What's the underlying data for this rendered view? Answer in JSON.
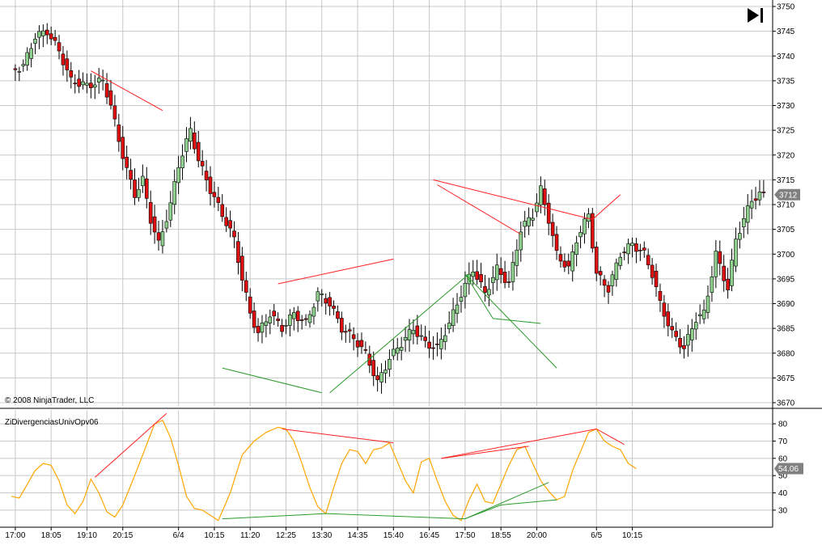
{
  "copyright": "© 2008 NinjaTrader, LLC",
  "play_icon": "skip-to-end-icon",
  "colors": {
    "up_candle": "#8fd08f",
    "down_candle": "#e01010",
    "grid": "#c8c8c8",
    "bearish_line": "#ff2020",
    "bullish_line": "#2a9a2a",
    "oscillator": "#ffa500",
    "last_badge": "#808080"
  },
  "chart_data": [
    {
      "type": "candlestick",
      "ylim": [
        3670,
        3750
      ],
      "yticks": [
        3670,
        3675,
        3680,
        3685,
        3690,
        3695,
        3700,
        3705,
        3710,
        3715,
        3720,
        3725,
        3730,
        3735,
        3740,
        3745,
        3750
      ],
      "last_price": "3712",
      "close_anchors": [
        [
          0,
          3737
        ],
        [
          3,
          3738
        ],
        [
          6,
          3744
        ],
        [
          9,
          3745
        ],
        [
          12,
          3741
        ],
        [
          15,
          3735
        ],
        [
          19,
          3734
        ],
        [
          23,
          3735
        ],
        [
          25,
          3730
        ],
        [
          27,
          3723
        ],
        [
          29,
          3717
        ],
        [
          31,
          3712
        ],
        [
          33,
          3715
        ],
        [
          35,
          3707
        ],
        [
          37,
          3702
        ],
        [
          40,
          3710
        ],
        [
          42,
          3718
        ],
        [
          45,
          3725
        ],
        [
          47,
          3719
        ],
        [
          50,
          3713
        ],
        [
          53,
          3708
        ],
        [
          56,
          3703
        ],
        [
          58,
          3695
        ],
        [
          60,
          3688
        ],
        [
          62,
          3684
        ],
        [
          65,
          3688
        ],
        [
          68,
          3685
        ],
        [
          71,
          3688
        ],
        [
          74,
          3686
        ],
        [
          77,
          3692
        ],
        [
          80,
          3690
        ],
        [
          83,
          3685
        ],
        [
          86,
          3683
        ],
        [
          89,
          3680
        ],
        [
          92,
          3674
        ],
        [
          95,
          3679
        ],
        [
          98,
          3682
        ],
        [
          101,
          3685
        ],
        [
          104,
          3682
        ],
        [
          107,
          3681
        ],
        [
          110,
          3686
        ],
        [
          113,
          3692
        ],
        [
          116,
          3697
        ],
        [
          119,
          3692
        ],
        [
          122,
          3697
        ],
        [
          125,
          3694
        ],
        [
          128,
          3705
        ],
        [
          131,
          3708
        ],
        [
          133,
          3713
        ],
        [
          135,
          3707
        ],
        [
          137,
          3700
        ],
        [
          140,
          3697
        ],
        [
          142,
          3703
        ],
        [
          145,
          3708
        ],
        [
          147,
          3696
        ],
        [
          150,
          3693
        ],
        [
          153,
          3700
        ],
        [
          156,
          3702
        ],
        [
          159,
          3700
        ],
        [
          161,
          3696
        ],
        [
          163,
          3690
        ],
        [
          166,
          3684
        ],
        [
          169,
          3681
        ],
        [
          172,
          3687
        ],
        [
          174,
          3688
        ],
        [
          177,
          3700
        ],
        [
          180,
          3693
        ],
        [
          182,
          3703
        ],
        [
          184,
          3707
        ],
        [
          186,
          3711
        ],
        [
          188,
          3712
        ]
      ],
      "bearish_divergence_lines": [
        [
          [
            20,
            3737
          ],
          [
            38,
            3729
          ]
        ],
        [
          [
            67,
            3694
          ],
          [
            96,
            3699
          ]
        ],
        [
          [
            106,
            3715
          ],
          [
            146,
            3707
          ]
        ],
        [
          [
            107,
            3714
          ],
          [
            128,
            3704
          ]
        ],
        [
          [
            146,
            3707
          ],
          [
            153,
            3712
          ]
        ]
      ],
      "bullish_divergence_lines": [
        [
          [
            53,
            3677
          ],
          [
            78,
            3672
          ]
        ],
        [
          [
            80,
            3672
          ],
          [
            115,
            3696
          ]
        ],
        [
          [
            114,
            3696
          ],
          [
            121,
            3687
          ]
        ],
        [
          [
            121,
            3687
          ],
          [
            133,
            3686
          ]
        ],
        [
          [
            114,
            3696
          ],
          [
            137,
            3677
          ]
        ]
      ]
    },
    {
      "type": "line",
      "title": "ZiDivergenciasUnivOpv06",
      "ylim": [
        22,
        88
      ],
      "yticks": [
        30,
        40,
        50,
        60,
        70,
        80
      ],
      "last_value": "54.06",
      "x_labels": [
        {
          "i": 1,
          "text": "17:00"
        },
        {
          "i": 10,
          "text": "18:05"
        },
        {
          "i": 19,
          "text": "19:10"
        },
        {
          "i": 28,
          "text": "20:15"
        },
        {
          "i": 42,
          "text": "6/4"
        },
        {
          "i": 51,
          "text": "10:15"
        },
        {
          "i": 60,
          "text": "11:20"
        },
        {
          "i": 69,
          "text": "12:25"
        },
        {
          "i": 78,
          "text": "13:30"
        },
        {
          "i": 87,
          "text": "14:35"
        },
        {
          "i": 96,
          "text": "15:40"
        },
        {
          "i": 105,
          "text": "16:45"
        },
        {
          "i": 114,
          "text": "17:50"
        },
        {
          "i": 123,
          "text": "18:55"
        },
        {
          "i": 132,
          "text": "20:00"
        },
        {
          "i": 147,
          "text": "6/5"
        },
        {
          "i": 156,
          "text": "10:15"
        }
      ],
      "values_anchors": [
        [
          0,
          38
        ],
        [
          2,
          37
        ],
        [
          4,
          45
        ],
        [
          6,
          53
        ],
        [
          8,
          57
        ],
        [
          10,
          56
        ],
        [
          12,
          47
        ],
        [
          14,
          33
        ],
        [
          16,
          28
        ],
        [
          18,
          35
        ],
        [
          20,
          48
        ],
        [
          22,
          40
        ],
        [
          24,
          29
        ],
        [
          26,
          26
        ],
        [
          28,
          33
        ],
        [
          31,
          50
        ],
        [
          34,
          68
        ],
        [
          36,
          80
        ],
        [
          38,
          82
        ],
        [
          40,
          72
        ],
        [
          42,
          56
        ],
        [
          44,
          38
        ],
        [
          46,
          31
        ],
        [
          48,
          30
        ],
        [
          50,
          27
        ],
        [
          52,
          24
        ],
        [
          55,
          40
        ],
        [
          58,
          62
        ],
        [
          61,
          70
        ],
        [
          64,
          75
        ],
        [
          67,
          78
        ],
        [
          69,
          77
        ],
        [
          71,
          70
        ],
        [
          73,
          57
        ],
        [
          75,
          43
        ],
        [
          77,
          32
        ],
        [
          79,
          28
        ],
        [
          81,
          43
        ],
        [
          83,
          57
        ],
        [
          85,
          65
        ],
        [
          87,
          64
        ],
        [
          89,
          57
        ],
        [
          91,
          65
        ],
        [
          93,
          66
        ],
        [
          95,
          69
        ],
        [
          97,
          58
        ],
        [
          99,
          47
        ],
        [
          101,
          40
        ],
        [
          103,
          58
        ],
        [
          105,
          60
        ],
        [
          107,
          47
        ],
        [
          109,
          35
        ],
        [
          111,
          27
        ],
        [
          113,
          24
        ],
        [
          115,
          36
        ],
        [
          117,
          45
        ],
        [
          119,
          35
        ],
        [
          121,
          34
        ],
        [
          123,
          45
        ],
        [
          125,
          56
        ],
        [
          127,
          65
        ],
        [
          129,
          67
        ],
        [
          131,
          57
        ],
        [
          133,
          47
        ],
        [
          135,
          41
        ],
        [
          137,
          36
        ],
        [
          139,
          38
        ],
        [
          141,
          53
        ],
        [
          143,
          64
        ],
        [
          145,
          75
        ],
        [
          147,
          77
        ],
        [
          149,
          70
        ],
        [
          151,
          67
        ],
        [
          153,
          65
        ],
        [
          155,
          57
        ],
        [
          157,
          54
        ]
      ],
      "bearish_divergence_lines": [
        [
          [
            21,
            49
          ],
          [
            39,
            86
          ]
        ],
        [
          [
            68,
            77
          ],
          [
            96,
            69
          ]
        ],
        [
          [
            108,
            60
          ],
          [
            147,
            77
          ]
        ],
        [
          [
            108,
            60
          ],
          [
            130,
            67
          ]
        ],
        [
          [
            147,
            77
          ],
          [
            154,
            68
          ]
        ]
      ],
      "bullish_divergence_lines": [
        [
          [
            53,
            25
          ],
          [
            79,
            28
          ]
        ],
        [
          [
            79,
            28
          ],
          [
            114,
            25
          ]
        ],
        [
          [
            114,
            25
          ],
          [
            123,
            33
          ]
        ],
        [
          [
            123,
            33
          ],
          [
            137,
            36
          ]
        ],
        [
          [
            114,
            25
          ],
          [
            135,
            46
          ]
        ]
      ]
    }
  ]
}
